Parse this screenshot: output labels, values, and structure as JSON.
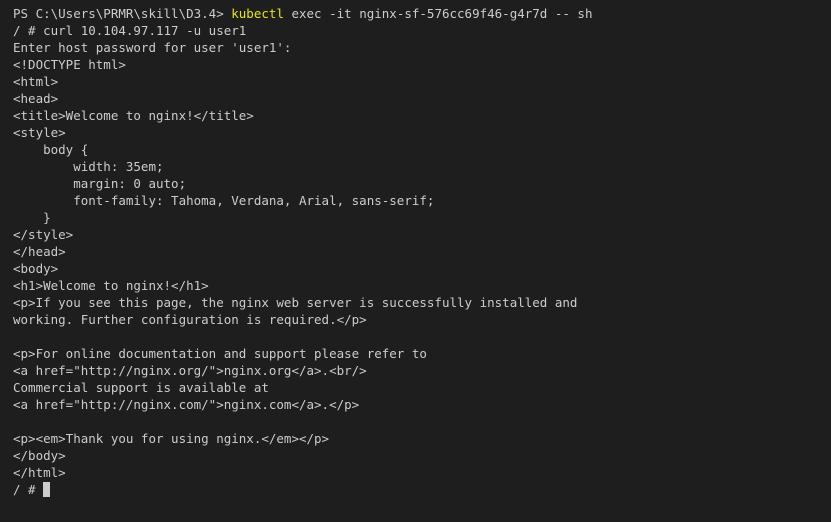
{
  "terminal": {
    "prompt_line": {
      "prompt": "PS C:\\Users\\PRMR\\skill\\D3.4> ",
      "command": "kubectl",
      "args": " exec -it nginx-sf-576cc69f46-g4r7d -- sh"
    },
    "output_lines": [
      "/ # curl 10.104.97.117 -u user1",
      "Enter host password for user 'user1':",
      "<!DOCTYPE html>",
      "<html>",
      "<head>",
      "<title>Welcome to nginx!</title>",
      "<style>",
      "    body {",
      "        width: 35em;",
      "        margin: 0 auto;",
      "        font-family: Tahoma, Verdana, Arial, sans-serif;",
      "    }",
      "</style>",
      "</head>",
      "<body>",
      "<h1>Welcome to nginx!</h1>",
      "<p>If you see this page, the nginx web server is successfully installed and",
      "working. Further configuration is required.</p>",
      "",
      "<p>For online documentation and support please refer to",
      "<a href=\"http://nginx.org/\">nginx.org</a>.<br/>",
      "Commercial support is available at",
      "<a href=\"http://nginx.com/\">nginx.com</a>.</p>",
      "",
      "<p><em>Thank you for using nginx.</em></p>",
      "</body>",
      "</html>"
    ],
    "final_prompt": "/ # ",
    "colors": {
      "background": "#1e1e1e",
      "text": "#cccccc",
      "command_highlight": "#e5e510"
    }
  }
}
